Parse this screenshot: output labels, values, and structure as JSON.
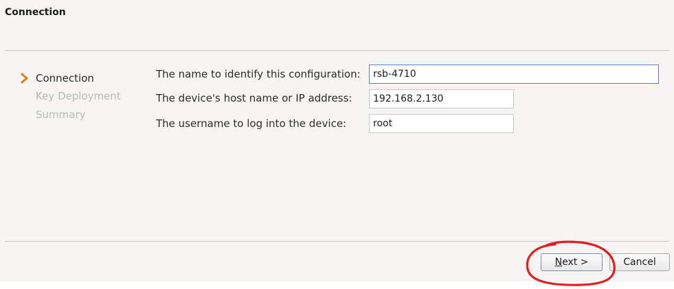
{
  "header": {
    "title": "Connection"
  },
  "steps": [
    {
      "label": "Connection",
      "state": "current"
    },
    {
      "label": "Key Deployment",
      "state": "pending"
    },
    {
      "label": "Summary",
      "state": "pending"
    }
  ],
  "form": {
    "name": {
      "label": "The name to identify this configuration:",
      "value": "rsb-4710"
    },
    "host": {
      "label": "The device's host name or IP address:",
      "value": "192.168.2.130"
    },
    "user": {
      "label": "The username to log into the device:",
      "value": "root"
    }
  },
  "buttons": {
    "next": "Next >",
    "next_mnemonic": "N",
    "cancel": "Cancel"
  },
  "colors": {
    "accent": "#e07a18",
    "annotation": "#e02020",
    "focus_border": "#5a7fbf"
  },
  "icons": {
    "current_step": "chevron-right-icon"
  }
}
